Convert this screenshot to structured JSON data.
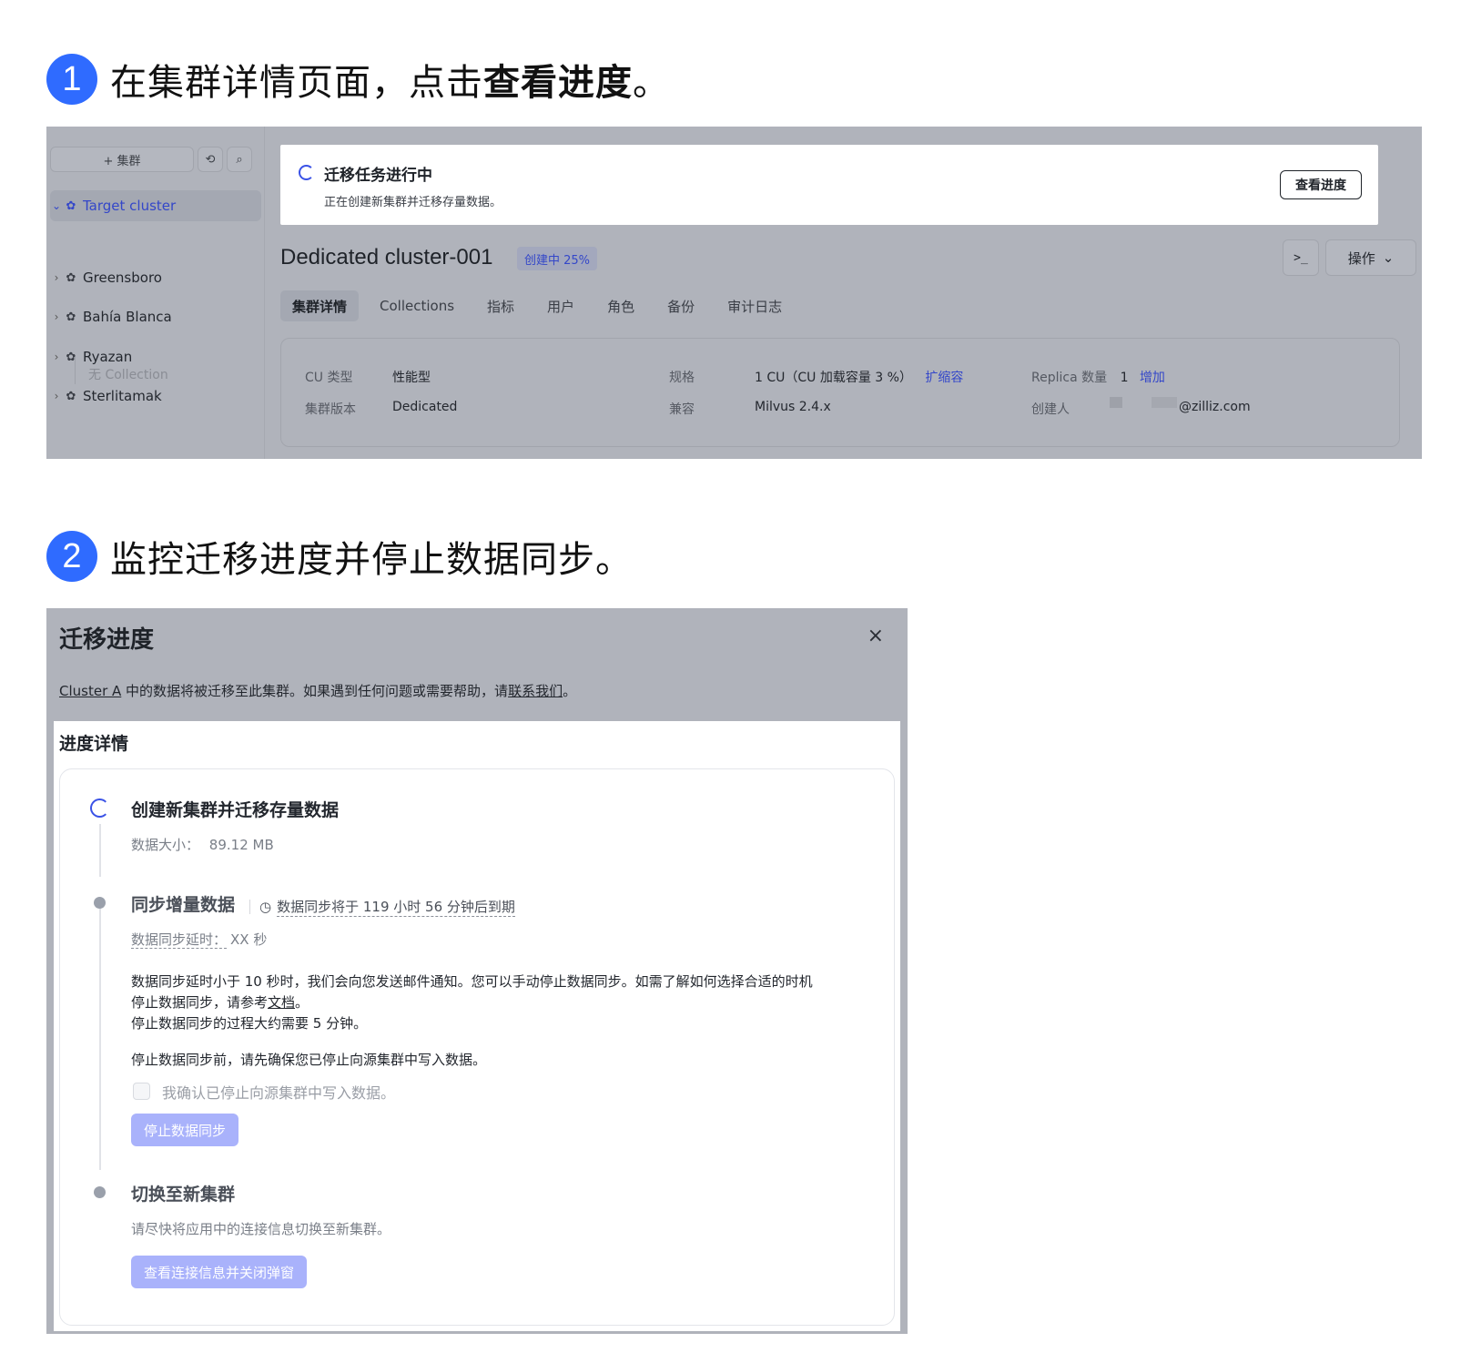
{
  "step1": {
    "number": "1",
    "text_prefix": "在集群详情页面，点击",
    "text_bold": "查看进度",
    "text_suffix": "。"
  },
  "step2": {
    "number": "2",
    "text": "监控迁移进度并停止数据同步。"
  },
  "cluster_page": {
    "sidebar": {
      "add_button": "+ 集群",
      "refresh_icon": "refresh-icon",
      "search_icon": "search-icon",
      "items": [
        {
          "label": "Target cluster",
          "expanded": true,
          "active": true
        },
        {
          "label": "Greensboro"
        },
        {
          "label": "Bahía Blanca"
        },
        {
          "label": "Ryazan"
        },
        {
          "label": "Sterlitamak"
        }
      ],
      "sub_item": "无 Collection"
    },
    "banner": {
      "title": "迁移任务进行中",
      "description": "正在创建新集群并迁移存量数据。",
      "button": "查看进度"
    },
    "cluster_name": "Dedicated cluster-001",
    "status_badge": "创建中 25%",
    "terminal_button": ">_",
    "ops_button": "操作",
    "tabs": [
      "集群详情",
      "Collections",
      "指标",
      "用户",
      "角色",
      "备份",
      "审计日志"
    ],
    "info": {
      "cu_type_label": "CU 类型",
      "cu_type_value": "性能型",
      "version_label": "集群版本",
      "version_value": "Dedicated",
      "spec_label": "规格",
      "spec_value": "1 CU（CU 加载容量 3 %）",
      "spec_link": "扩缩容",
      "compat_label": "兼容",
      "compat_value": "Milvus 2.4.x",
      "replica_label": "Replica 数量",
      "replica_value": "1",
      "replica_link": "增加",
      "creator_label": "创建人",
      "creator_value": "@zilliz.com"
    }
  },
  "migration_modal": {
    "title": "迁移进度",
    "close_icon": "close-icon",
    "desc_link1": "Cluster A",
    "desc_mid": " 中的数据将被迁移至此集群。如果遇到任何问题或需要帮助，请",
    "desc_link2": "联系我们",
    "desc_end": "。",
    "subtitle": "进度详情",
    "steps": {
      "s1_title": "创建新集群并迁移存量数据",
      "s1_size_label": "数据大小：",
      "s1_size_value": "89.12 MB",
      "s2_title": "同步增量数据",
      "s2_expire": "数据同步将于 119 小时 56 分钟后到期",
      "s2_latency_label": "数据同步延时：",
      "s2_latency_value": "XX 秒",
      "s2_para1_a": "数据同步延时小于 10 秒时，我们会向您发送邮件通知。您可以手动停止数据同步。如需了解如何选择合适的时机",
      "s2_para1_b": "停止数据同步，请参考",
      "s2_para1_link": "文档",
      "s2_para1_c": "。",
      "s2_para2": "停止数据同步的过程大约需要 5 分钟。",
      "s2_para3": "停止数据同步前，请先确保您已停止向源集群中写入数据。",
      "s2_checkbox": "我确认已停止向源集群中写入数据。",
      "s2_button": "停止数据同步",
      "s3_title": "切换至新集群",
      "s3_text": "请尽快将应用中的连接信息切换至新集群。",
      "s3_button": "查看连接信息并关闭弹窗"
    }
  }
}
